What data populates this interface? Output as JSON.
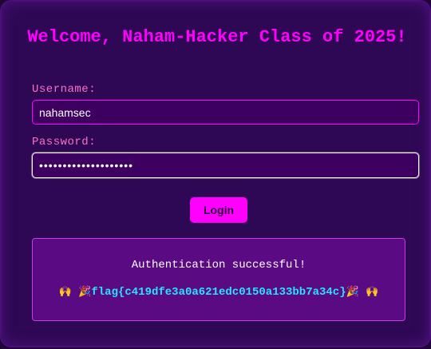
{
  "page": {
    "title": "Welcome, Naham-Hacker Class of 2025!"
  },
  "form": {
    "username_label": "Username:",
    "username_value": "nahamsec",
    "password_label": "Password:",
    "password_value": "••••••••••••••••••••",
    "login_label": "Login"
  },
  "result": {
    "message": "Authentication successful!",
    "emoji_hands": "🙌",
    "emoji_party": "🎉",
    "flag": "flag{c419dfe3a0a621edc0150a133bb7a34c}"
  },
  "colors": {
    "background": "#2e0854",
    "accent": "#ff00ff",
    "label": "#ff6ec7",
    "flag": "#29e3ff",
    "result_panel": "#5a0a82"
  }
}
